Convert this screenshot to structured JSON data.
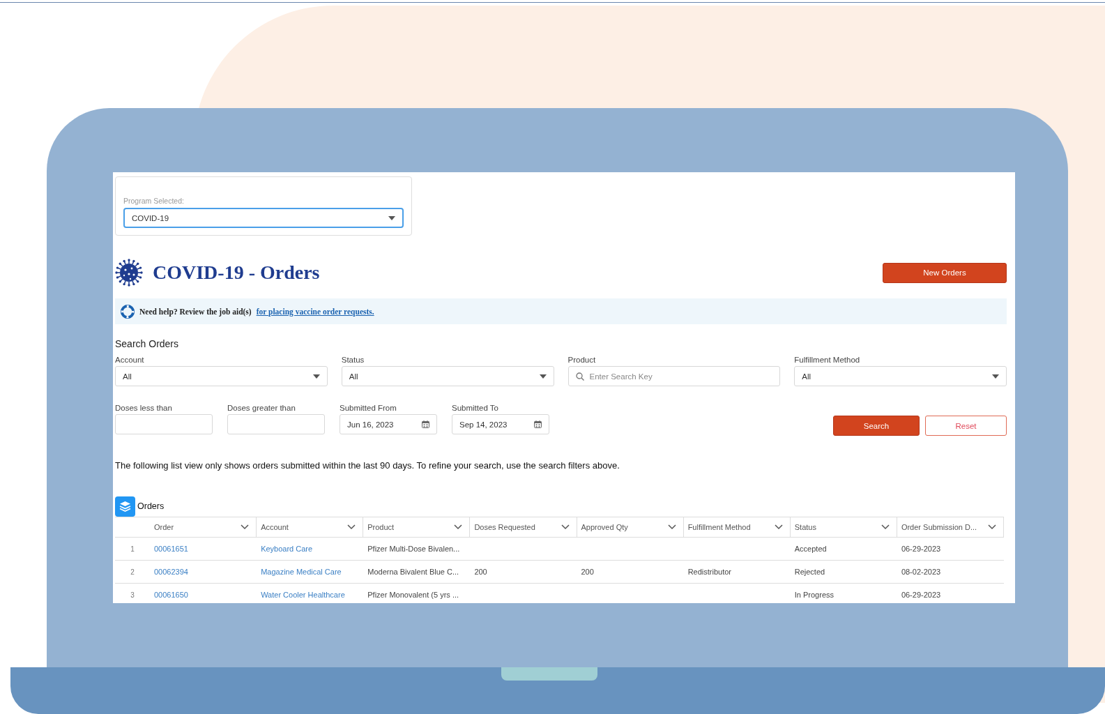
{
  "program_selector": {
    "label": "Program Selected:",
    "value": "COVID-19"
  },
  "header": {
    "title": "COVID-19 - Orders",
    "button": "New Orders"
  },
  "help": {
    "text": "Need help? Review the job aid(s)",
    "link": "for placing vaccine order requests."
  },
  "search": {
    "title": "Search Orders",
    "filters": [
      {
        "kind": "select",
        "label": "Account",
        "value": "All"
      },
      {
        "kind": "select",
        "label": "Status",
        "value": "All"
      },
      {
        "kind": "search",
        "label": "Product",
        "placeholder": "Enter Search Key"
      },
      {
        "kind": "select",
        "label": "Fulfillment Method",
        "value": "All"
      }
    ],
    "filters_2": [
      {
        "kind": "text",
        "label": "Doses less than"
      },
      {
        "kind": "text",
        "label": "Doses greater than"
      },
      {
        "kind": "date",
        "label": "Submitted From",
        "value": "Jun 16, 2023"
      },
      {
        "kind": "date",
        "label": "Submitted To",
        "value": "Sep 14, 2023"
      }
    ],
    "buttons": [
      {
        "kind": "primary",
        "label": "Search"
      },
      {
        "kind": "outline",
        "label": "Reset"
      }
    ]
  },
  "notice": "The following list view only shows orders submitted within the last 90 days. To refine your search, use the search filters above.",
  "orders": {
    "title": "Orders",
    "columns": [
      "Order",
      "Account",
      "Product",
      "Doses Requested",
      "Approved Qty",
      "Fulfillment Method",
      "Status",
      "Order Submission D..."
    ],
    "rows": [
      {
        "number": "1",
        "order": "00061651",
        "account": "Keyboard Care",
        "product": "Pfizer Multi-Dose Bivalen...",
        "status": "Accepted",
        "submitted": "06-29-2023"
      },
      {
        "number": "2",
        "order": "00062394",
        "account": "Magazine Medical Care",
        "product": "Moderna Bivalent Blue C...",
        "doses_requested": "200",
        "approved_qty": "200",
        "fulfillment_method": "Redistributor",
        "status": "Rejected",
        "submitted": "08-02-2023"
      },
      {
        "number": "3",
        "order": "00061650",
        "account": "Water Cooler Healthcare",
        "product": "Pfizer Monovalent (5 yrs ...",
        "status": "In Progress",
        "submitted": "06-29-2023"
      }
    ]
  }
}
